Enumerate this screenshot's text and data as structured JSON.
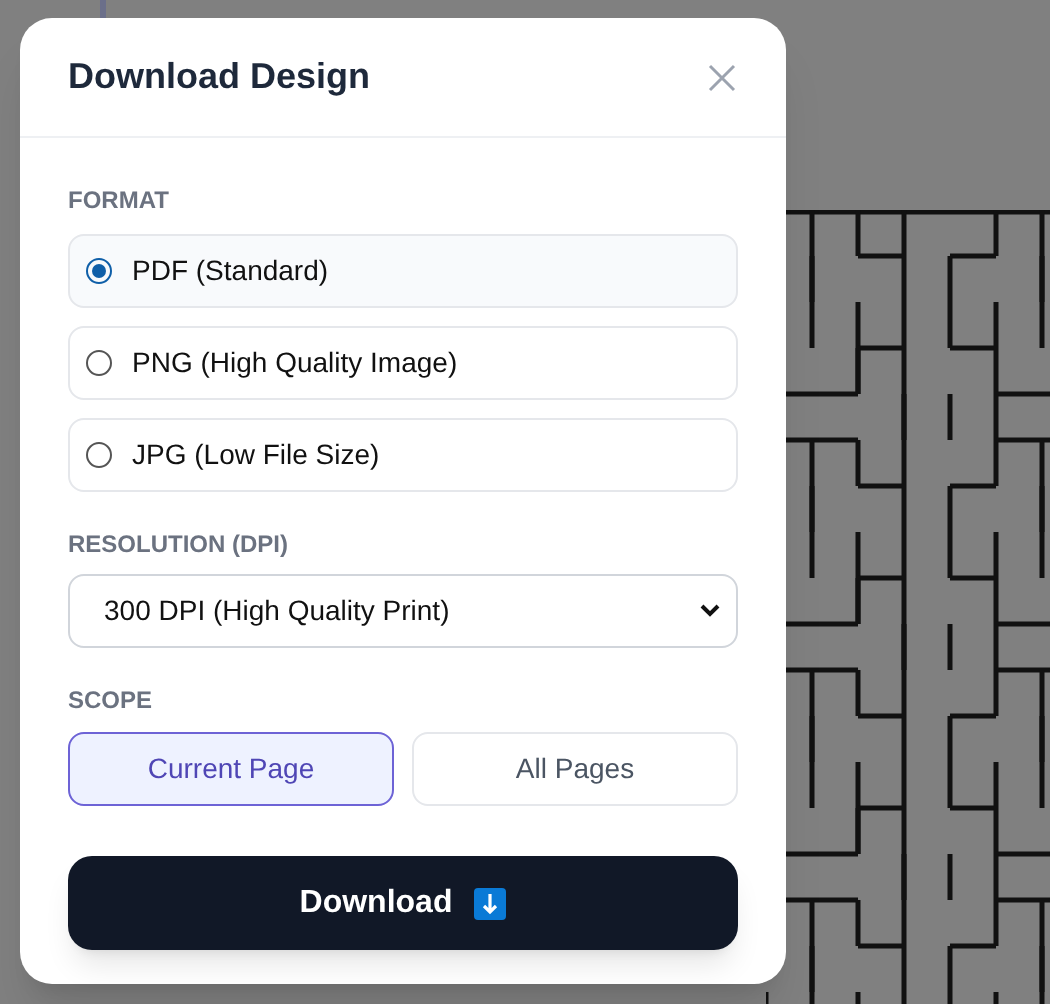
{
  "dialog": {
    "title": "Download Design",
    "close": {
      "kind": "close"
    }
  },
  "format": {
    "label": "FORMAT",
    "options": [
      {
        "label": "PDF (Standard)",
        "selected": true
      },
      {
        "label": "PNG (High Quality Image)",
        "selected": false
      },
      {
        "label": "JPG (Low File Size)",
        "selected": false
      }
    ]
  },
  "resolution": {
    "label": "RESOLUTION (DPI)",
    "value": "300 DPI (High Quality Print)"
  },
  "scope": {
    "label": "SCOPE",
    "options": [
      {
        "label": "Current Page",
        "selected": true
      },
      {
        "label": "All Pages",
        "selected": false
      }
    ]
  },
  "download_button": {
    "label": "Download"
  }
}
